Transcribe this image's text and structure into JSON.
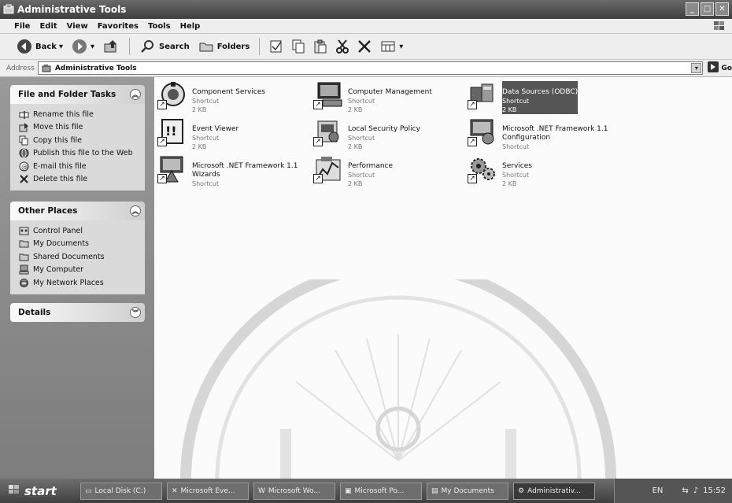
{
  "window": {
    "title": "Administrative Tools"
  },
  "menu": [
    "File",
    "Edit",
    "View",
    "Favorites",
    "Tools",
    "Help"
  ],
  "toolbar": {
    "back": "Back",
    "search": "Search",
    "folders": "Folders"
  },
  "address": {
    "label": "Address",
    "value": "Administrative Tools",
    "go": "Go"
  },
  "tasks_panel": {
    "title": "File and Folder Tasks",
    "items": [
      {
        "label": "Rename this file",
        "icon": "rename-icon"
      },
      {
        "label": "Move this file",
        "icon": "move-icon"
      },
      {
        "label": "Copy this file",
        "icon": "copy-icon"
      },
      {
        "label": "Publish this file to the Web",
        "icon": "globe-icon"
      },
      {
        "label": "E-mail this file",
        "icon": "email-icon"
      },
      {
        "label": "Delete this file",
        "icon": "delete-icon"
      }
    ]
  },
  "places_panel": {
    "title": "Other Places",
    "items": [
      {
        "label": "Control Panel",
        "icon": "control-panel-icon"
      },
      {
        "label": "My Documents",
        "icon": "folder-icon"
      },
      {
        "label": "Shared Documents",
        "icon": "folder-icon"
      },
      {
        "label": "My Computer",
        "icon": "computer-icon"
      },
      {
        "label": "My Network Places",
        "icon": "network-icon"
      }
    ]
  },
  "details_panel": {
    "title": "Details"
  },
  "files": [
    {
      "name": "Component Services",
      "line2": "Shortcut",
      "line3": "2 KB",
      "icon": "component-services-icon"
    },
    {
      "name": "Computer Management",
      "line2": "Shortcut",
      "line3": "2 KB",
      "icon": "computer-management-icon"
    },
    {
      "name": "Data Sources (ODBC)",
      "line2": "Shortcut",
      "line3": "2 KB",
      "icon": "data-sources-icon",
      "selected": true
    },
    {
      "name": "Event Viewer",
      "line2": "Shortcut",
      "line3": "2 KB",
      "icon": "event-viewer-icon"
    },
    {
      "name": "Local Security Policy",
      "line2": "Shortcut",
      "line3": "2 KB",
      "icon": "security-policy-icon"
    },
    {
      "name": "Microsoft .NET Framework 1.1 Configuration",
      "line2": "Shortcut",
      "line3": "",
      "icon": "net-config-icon"
    },
    {
      "name": "Microsoft .NET Framework 1.1 Wizards",
      "line2": "Shortcut",
      "line3": "",
      "icon": "net-wizards-icon"
    },
    {
      "name": "Performance",
      "line2": "Shortcut",
      "line3": "2 KB",
      "icon": "performance-icon"
    },
    {
      "name": "Services",
      "line2": "Shortcut",
      "line3": "2 KB",
      "icon": "services-icon"
    }
  ],
  "taskbar": {
    "start": "start",
    "buttons": [
      "Local Disk (C:)",
      "Microsoft Eve...",
      "Microsoft Wo...",
      "Microsoft Po...",
      "My Documents",
      "Administrativ..."
    ],
    "lang": "EN",
    "clock": "15:52"
  }
}
